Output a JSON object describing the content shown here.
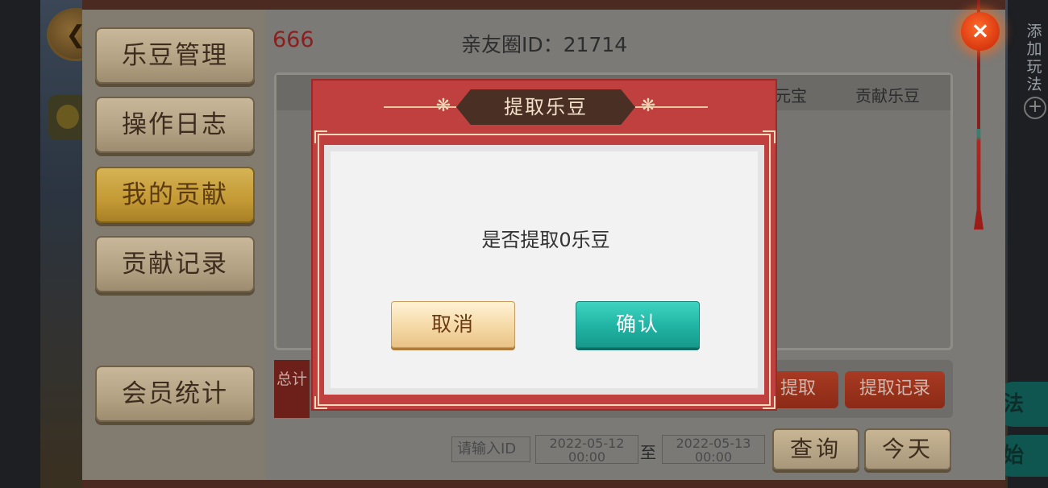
{
  "background": {
    "side_text": "添加玩法",
    "green_btn_1": "法",
    "green_btn_2": "始"
  },
  "sidebar": {
    "items": [
      {
        "label": "乐豆管理"
      },
      {
        "label": "操作日志"
      },
      {
        "label": "我的贡献"
      },
      {
        "label": "贡献记录"
      },
      {
        "label": "会员统计"
      }
    ]
  },
  "header": {
    "number": "666",
    "circle_id": "亲友圈ID：21714"
  },
  "table": {
    "columns": [
      "元宝",
      "贡献乐豆"
    ]
  },
  "total_bar": {
    "tag": "总计",
    "withdraw_label": "提取",
    "withdraw_record_label": "提取记录"
  },
  "search": {
    "placeholder": "请输入ID",
    "date_from_day": "2022-05-12",
    "date_from_time": "00:00",
    "to_label": "至",
    "date_to_day": "2022-05-13",
    "date_to_time": "00:00",
    "query_label": "查询",
    "today_label": "今天"
  },
  "dialog": {
    "title": "提取乐豆",
    "message": "是否提取0乐豆",
    "cancel_label": "取消",
    "confirm_label": "确认"
  },
  "close_icon": "×",
  "colors": {
    "dialog_red": "#c0403f",
    "confirm_teal": "#20b3a3",
    "active_gold": "#c39a34"
  }
}
